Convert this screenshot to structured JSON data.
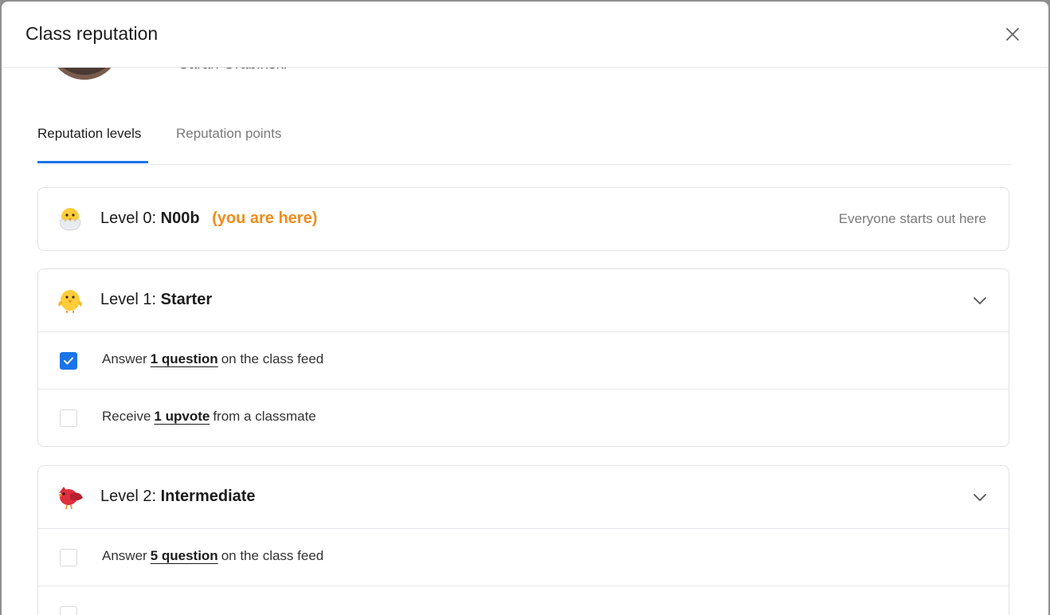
{
  "dialog": {
    "title": "Class reputation"
  },
  "profile": {
    "name": "Sarah Grabinski"
  },
  "tabs": [
    {
      "label": "Reputation levels",
      "active": true
    },
    {
      "label": "Reputation points",
      "active": false
    }
  ],
  "levels": [
    {
      "prefix": "Level 0:",
      "name": "N00b",
      "you_are_here": "(you are here)",
      "note": "Everyone starts out here",
      "icon": "hatching-chick-icon"
    },
    {
      "prefix": "Level 1:",
      "name": "Starter",
      "icon": "front-facing-chick-icon",
      "tasks": [
        {
          "before": "Answer",
          "link": "1 question",
          "after": "on the class feed",
          "checked": true
        },
        {
          "before": "Receive",
          "link": "1 upvote",
          "after": "from a classmate",
          "checked": false
        }
      ]
    },
    {
      "prefix": "Level 2:",
      "name": "Intermediate",
      "icon": "red-bird-icon",
      "tasks": [
        {
          "before": "Answer",
          "link": "5 question",
          "after": "on the class feed",
          "checked": false
        }
      ]
    }
  ],
  "colors": {
    "accent": "#1a73e8",
    "highlight": "#f28c1a",
    "muted": "#7a7a7a"
  }
}
